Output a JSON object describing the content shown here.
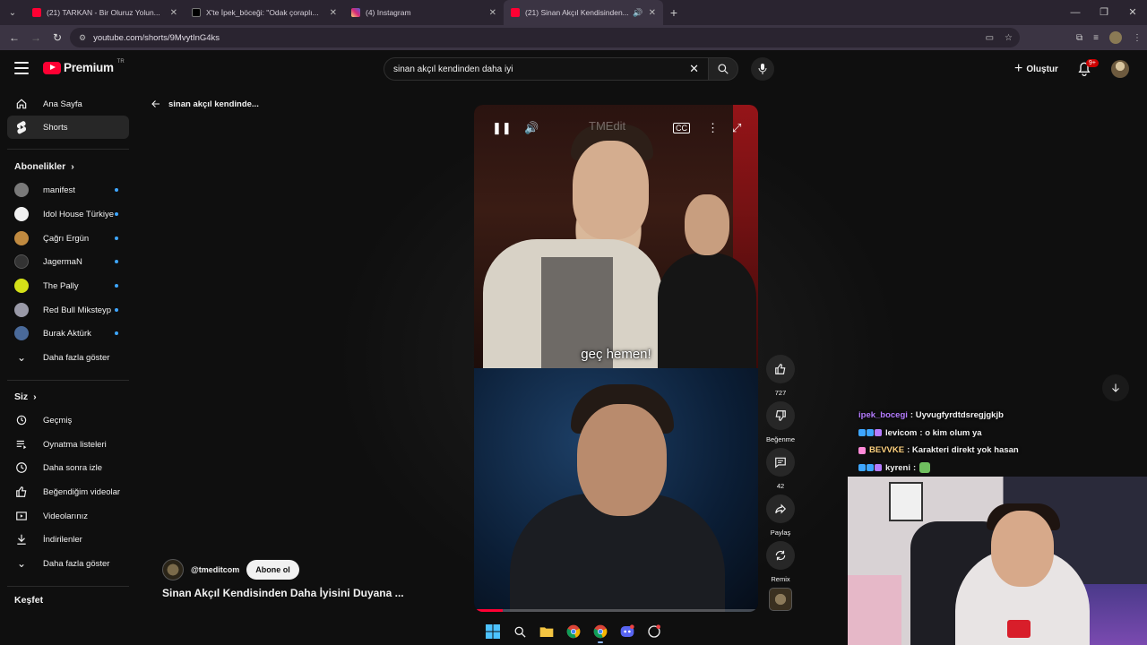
{
  "browser": {
    "tabs": [
      {
        "title": "(21) TARKAN - Bir Oluruz Yolun...",
        "favicon_color": "#ff0033"
      },
      {
        "title": "X'te İpek_böceği: \"Odak çoraplı...",
        "favicon_color": "#000000"
      },
      {
        "title": "(4) Instagram",
        "favicon_color": "#d6249f"
      },
      {
        "title": "(21) Sinan Akçıl Kendisinden...",
        "favicon_color": "#ff0033",
        "active": true
      }
    ],
    "url": "youtube.com/shorts/9MvytInG4ks"
  },
  "header": {
    "logo_text": "Premium",
    "logo_country": "TR",
    "search_value": "sinan akçıl kendinden daha iyi",
    "create_label": "Oluştur",
    "notification_count": "9+"
  },
  "sidebar": {
    "main": [
      {
        "label": "Ana Sayfa",
        "icon": "home-icon"
      },
      {
        "label": "Shorts",
        "icon": "shorts-icon",
        "selected": true
      }
    ],
    "subscriptions_heading": "Abonelikler",
    "subscriptions": [
      {
        "label": "manifest",
        "color": "#7a7a7a"
      },
      {
        "label": "Idol House Türkiye",
        "color": "#f1f1f1"
      },
      {
        "label": "Çağrı Ergün",
        "color": "#c08a40"
      },
      {
        "label": "JagermaN",
        "color": "#333333"
      },
      {
        "label": "The Pally",
        "color": "#d4e018"
      },
      {
        "label": "Red Bull Miksteyp",
        "color": "#9a9aa8"
      },
      {
        "label": "Burak Aktürk",
        "color": "#4a6a9a"
      }
    ],
    "subscriptions_more": "Daha fazla göster",
    "you_heading": "Siz",
    "you": [
      {
        "label": "Geçmiş",
        "icon": "history-icon"
      },
      {
        "label": "Oynatma listeleri",
        "icon": "playlist-icon"
      },
      {
        "label": "Daha sonra izle",
        "icon": "clock-icon"
      },
      {
        "label": "Beğendiğim videolar",
        "icon": "thumb-up-icon"
      },
      {
        "label": "Videolarınız",
        "icon": "video-icon"
      },
      {
        "label": "İndirilenler",
        "icon": "download-icon"
      }
    ],
    "you_more": "Daha fazla göster",
    "explore_heading": "Keşfet"
  },
  "shorts": {
    "back_label": "sinan akçıl kendinde...",
    "caption": "geç hemen!",
    "watermark": "TMEdit",
    "progress": 0.1,
    "channel": "@tmeditcom",
    "subscribe_label": "Abone ol",
    "title": "Sinan Akçıl Kendisinden Daha İyisini Duyana ...",
    "actions": {
      "like_count": "727",
      "dislike_label": "Beğenme",
      "comment_count": "42",
      "share_label": "Paylaş",
      "remix_label": "Remix"
    }
  },
  "chat": [
    {
      "user": "ipek_bocegi",
      "color": "#b57cff",
      "msg": ": Uyvugfyrdtdsregjgkjb",
      "badges": []
    },
    {
      "user": "levicom",
      "color": "#f1f1f1",
      "msg": ": o kim olum ya",
      "badges": [
        "#3ea6ff",
        "#3ea6ff",
        "#b57cff"
      ]
    },
    {
      "user": "BEVVKE",
      "color": "#ffd27f",
      "msg": ": Karakteri direkt yok hasan",
      "badges": [
        "#ff8ad8"
      ]
    },
    {
      "user": "kyreni",
      "color": "#f1f1f1",
      "msg": ":",
      "badges": [
        "#3ea6ff",
        "#3ea6ff",
        "#b57cff"
      ]
    }
  ]
}
